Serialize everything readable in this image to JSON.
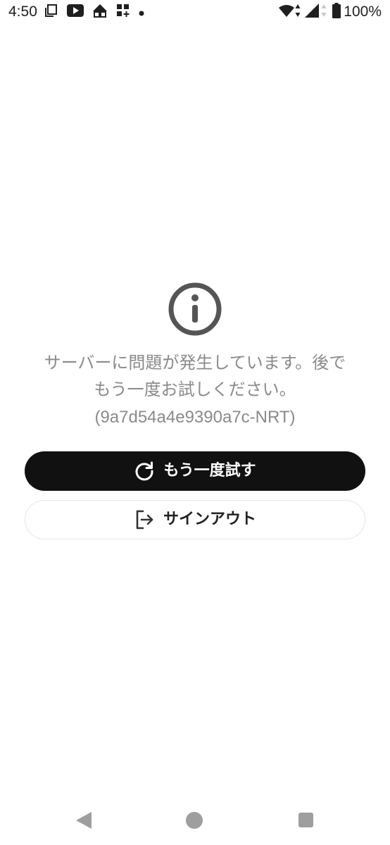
{
  "status_bar": {
    "time": "4:50",
    "battery_percent": "100%",
    "icons_left": [
      "copy-icon",
      "youtube-icon",
      "tent-icon",
      "widgets-icon",
      "dot-icon"
    ],
    "icons_right": [
      "wifi-icon",
      "data-arrows-icon",
      "signal-icon",
      "battery-icon"
    ]
  },
  "error": {
    "icon": "info-icon",
    "message_line1": "サーバーに問題が発生しています。後で",
    "message_line2": "もう一度お試しください。",
    "code": "(9a7d54a4e9390a7c-NRT)"
  },
  "buttons": {
    "retry": {
      "label": "もう一度試す",
      "icon": "refresh-icon"
    },
    "signout": {
      "label": "サインアウト",
      "icon": "logout-icon"
    }
  },
  "nav_bar": {
    "icons": [
      "back-icon",
      "home-icon",
      "recents-icon"
    ]
  },
  "colors": {
    "background": "#ffffff",
    "primary_button": "#111111",
    "message_text": "#8a8a8a",
    "icon_gray": "#555555"
  }
}
